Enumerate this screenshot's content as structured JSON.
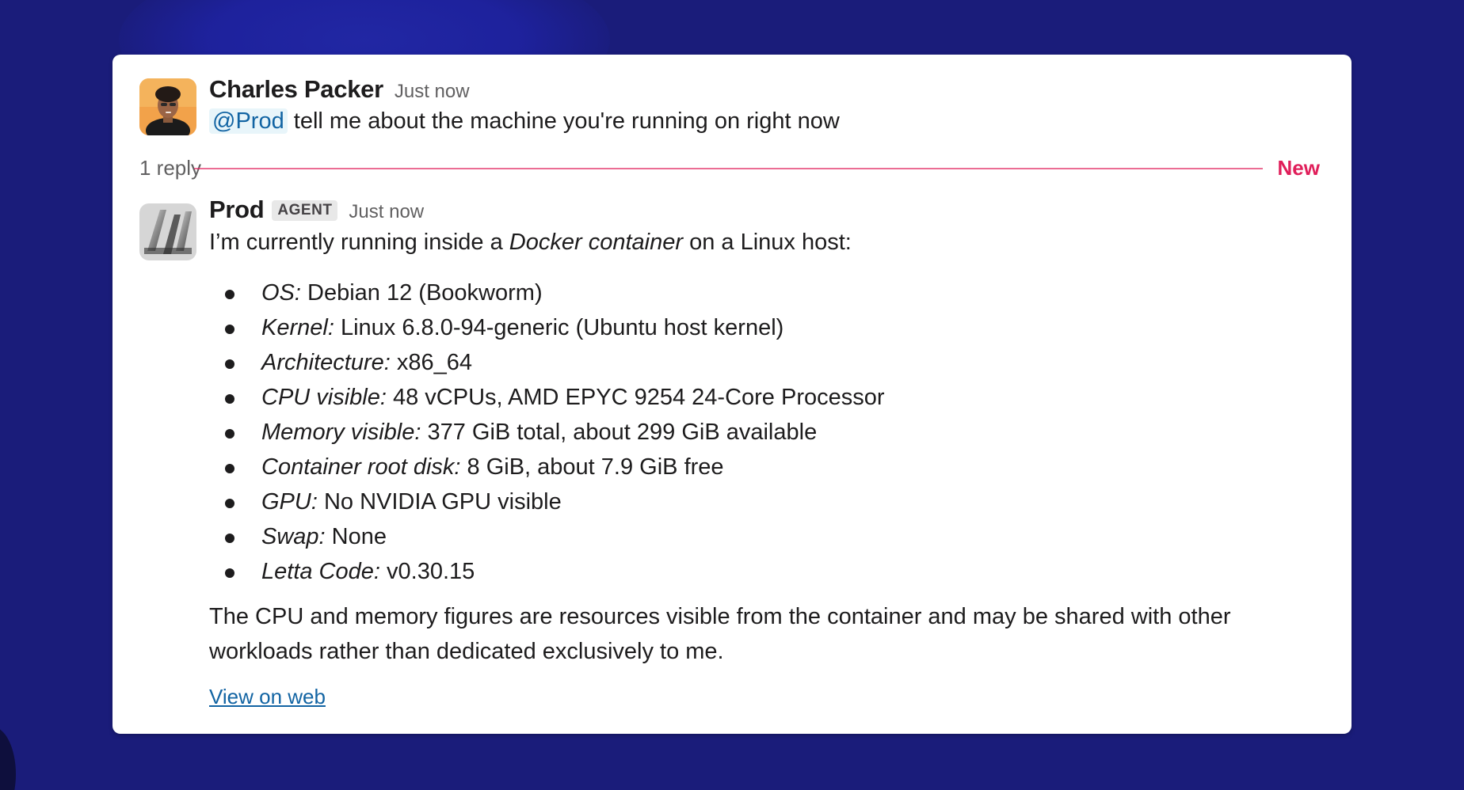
{
  "colors": {
    "background": "#1a1c7a",
    "card": "#ffffff",
    "mention_text": "#1264a3",
    "mention_bg": "#e8f5fa",
    "new_marker": "#e01e5a",
    "link": "#1264a3"
  },
  "thread": {
    "parent": {
      "author": "Charles Packer",
      "timestamp": "Just now",
      "avatar_icon": "person-photo-avatar",
      "mention": "@Prod",
      "text": " tell me about the machine you're running on right now"
    },
    "reply_count": "1 reply",
    "new_label": "New",
    "reply": {
      "author": "Prod",
      "badge": "AGENT",
      "timestamp": "Just now",
      "avatar_icon": "letta-logo-avatar",
      "intro_before": "I’m currently running inside a ",
      "intro_em": "Docker container",
      "intro_after": " on a Linux host:",
      "specs": [
        {
          "key": "OS:",
          "value": " Debian 12 (Bookworm)"
        },
        {
          "key": "Kernel:",
          "value": " Linux 6.8.0-94-generic (Ubuntu host kernel)"
        },
        {
          "key": "Architecture:",
          "value": " x86_64"
        },
        {
          "key": "CPU visible:",
          "value": " 48 vCPUs, AMD EPYC 9254 24-Core Processor"
        },
        {
          "key": "Memory visible:",
          "value": " 377 GiB total, about 299 GiB available"
        },
        {
          "key": "Container root disk:",
          "value": " 8 GiB, about 7.9 GiB free"
        },
        {
          "key": "GPU:",
          "value": " No NVIDIA GPU visible"
        },
        {
          "key": "Swap:",
          "value": " None"
        },
        {
          "key": "Letta Code:",
          "value": " v0.30.15"
        }
      ],
      "closing": "The CPU and memory figures are resources visible from the container and may be shared with other workloads rather than dedicated exclusively to me.",
      "link_label": "View on web"
    }
  }
}
